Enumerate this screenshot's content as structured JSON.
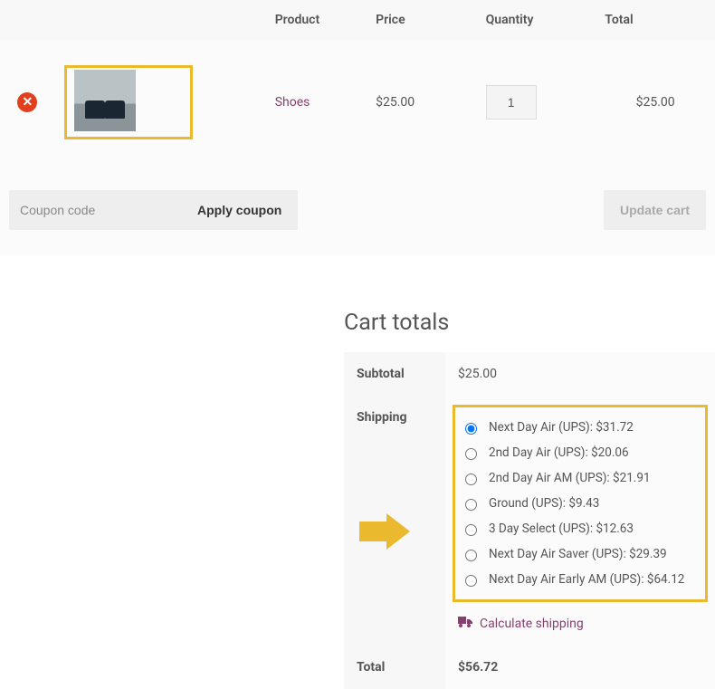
{
  "headers": {
    "product": "Product",
    "price": "Price",
    "quantity": "Quantity",
    "total": "Total"
  },
  "item": {
    "name": "Shoes",
    "price": "$25.00",
    "qty": "1",
    "total": "$25.00"
  },
  "coupon": {
    "placeholder": "Coupon code",
    "apply": "Apply coupon"
  },
  "update_cart": "Update cart",
  "totals": {
    "title": "Cart totals",
    "subtotal_label": "Subtotal",
    "subtotal": "$25.00",
    "shipping_label": "Shipping",
    "methods": [
      {
        "label": "Next Day Air (UPS): $31.72",
        "selected": true
      },
      {
        "label": "2nd Day Air (UPS): $20.06",
        "selected": false
      },
      {
        "label": "2nd Day Air AM (UPS): $21.91",
        "selected": false
      },
      {
        "label": "Ground (UPS): $9.43",
        "selected": false
      },
      {
        "label": "3 Day Select (UPS): $12.63",
        "selected": false
      },
      {
        "label": "Next Day Air Saver (UPS): $29.39",
        "selected": false
      },
      {
        "label": "Next Day Air Early AM (UPS): $64.12",
        "selected": false
      }
    ],
    "calc": "Calculate shipping",
    "total_label": "Total",
    "total": "$56.72"
  }
}
